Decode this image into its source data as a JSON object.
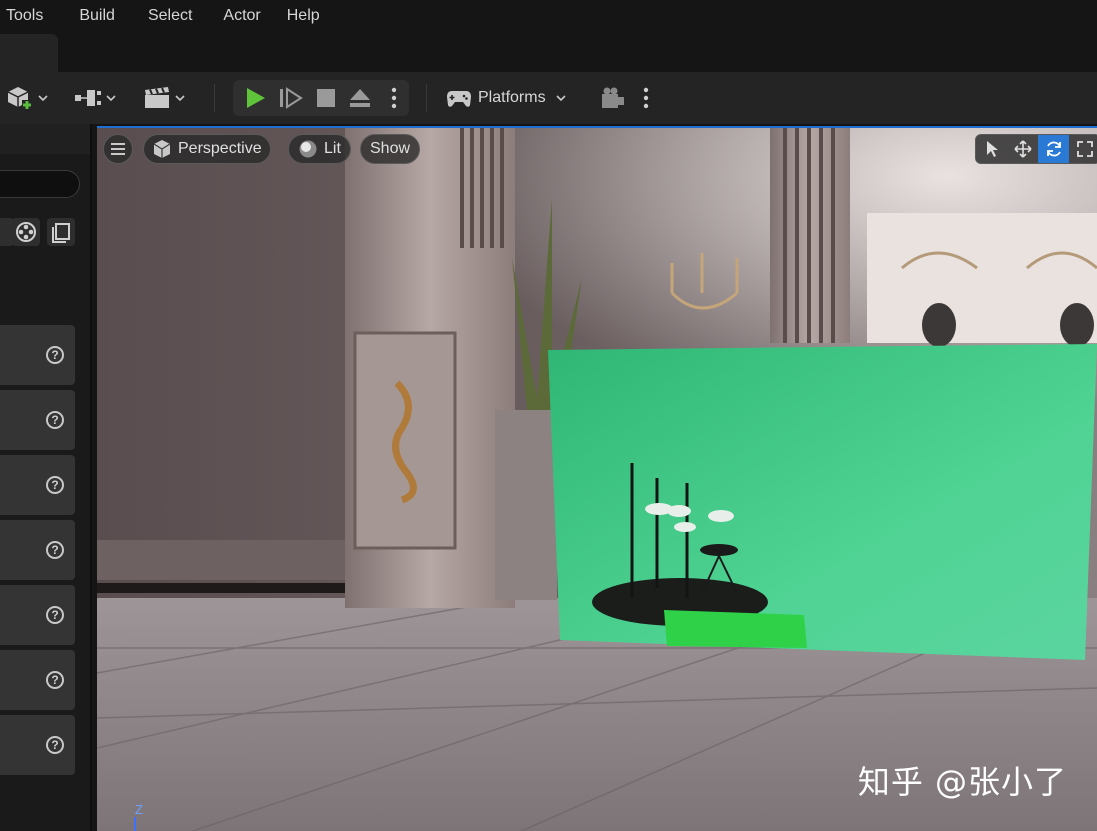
{
  "menu": {
    "items": [
      "Tools",
      "Build",
      "Select",
      "Actor",
      "Help"
    ]
  },
  "toolbar": {
    "platforms_label": "Platforms"
  },
  "viewport": {
    "perspective_label": "Perspective",
    "lit_label": "Lit",
    "show_label": "Show",
    "watermark": "知乎 @张小了",
    "axis_label": "Z"
  },
  "left_panel": {
    "item_count": 7,
    "help_glyph": "?"
  }
}
